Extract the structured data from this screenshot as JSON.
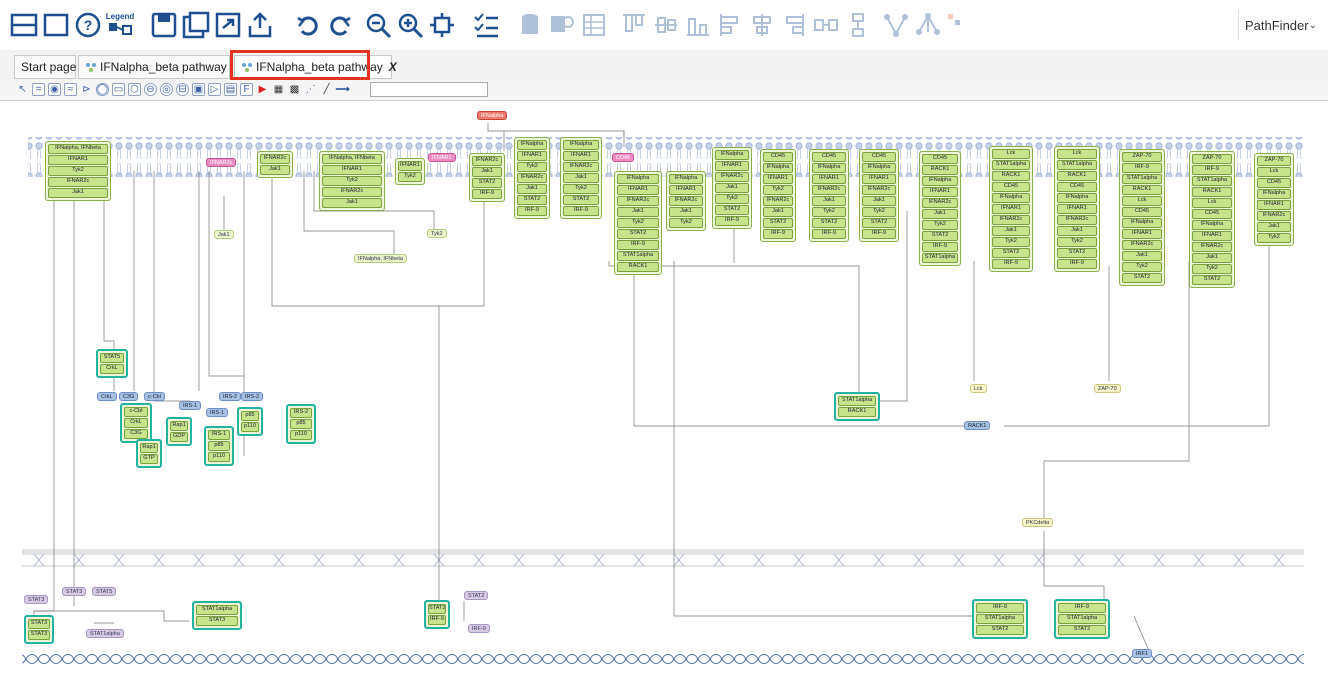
{
  "window": {
    "title": "IFNalpha_beta pathway"
  },
  "toolbar": {
    "legend_label": "Legend",
    "buttons": [
      "layout-panel",
      "single-panel",
      "help",
      "legend",
      "save",
      "save-as",
      "export",
      "upload",
      "undo",
      "redo",
      "zoom-out",
      "zoom-in",
      "fit",
      "checklist",
      "database",
      "search-db",
      "grid",
      "align-top",
      "align-middle",
      "align-bottom",
      "align-left",
      "align-center",
      "align-right",
      "distribute-h",
      "distribute-v",
      "network",
      "tree",
      "small-icon"
    ],
    "pathfinder_label": "PathFinder"
  },
  "tabs": [
    {
      "label": "Start page",
      "active": false
    },
    {
      "label": "IFNalpha_beta pathway ...",
      "active": false
    },
    {
      "label": "IFNalpha_beta pathway",
      "active": true
    }
  ],
  "tab_close_symbol": "X",
  "canvas": {
    "complexes": [
      {
        "id": "c1",
        "items": [
          "IFNalpha, IFNbeta",
          "IFNAR1",
          "Tyk2",
          "IFNAR2c",
          "Jak1"
        ]
      },
      {
        "id": "c2",
        "items": [
          "IFNAR2c",
          "Jak1"
        ]
      },
      {
        "id": "c3",
        "items": [
          "IFNalpha, IFNbeta",
          "IFNAR1",
          "Tyk2",
          "IFNAR2c",
          "Jak1"
        ]
      },
      {
        "id": "c4",
        "items": [
          "IFNAR1",
          "Tyk2"
        ]
      },
      {
        "id": "c5",
        "items": [
          "IFNAR2c",
          "Jak1",
          "STAT2",
          "IRF-9"
        ]
      },
      {
        "id": "c6",
        "items": [
          "IFNalpha",
          "IFNAR1",
          "Tyk2",
          "IFNAR2c",
          "Jak1",
          "STAT2",
          "IRF-9"
        ]
      },
      {
        "id": "c7",
        "items": [
          "IFNalpha",
          "IFNAR1",
          "IFNAR2c",
          "Jak1",
          "Tyk2",
          "STAT2",
          "IRF-9"
        ]
      },
      {
        "id": "c8",
        "items": [
          "IFNalpha",
          "IFNAR1",
          "IFNAR2c",
          "Jak1",
          "Tyk2",
          "STAT2",
          "IRF-9",
          "STAT1alpha",
          "RACK1"
        ]
      },
      {
        "id": "c9",
        "items": [
          "IFNalpha",
          "IFNAR1",
          "IFNAR2c",
          "Jak1",
          "Tyk2"
        ]
      },
      {
        "id": "c10",
        "items": [
          "IFNalpha",
          "IFNAR1",
          "IFNAR2c",
          "Jak1",
          "Tyk2",
          "STAT2",
          "IRF-9"
        ]
      },
      {
        "id": "c11",
        "items": [
          "CD45",
          "IFNalpha",
          "IFNAR1",
          "Tyk2",
          "IFNAR2c",
          "Jak1",
          "STAT2",
          "IRF-9"
        ]
      },
      {
        "id": "c12",
        "items": [
          "CD45",
          "IFNalpha",
          "IFNAR1",
          "IFNAR2c",
          "Jak1",
          "Tyk2",
          "STAT2",
          "IRF-9"
        ]
      },
      {
        "id": "c13",
        "items": [
          "CD45",
          "IFNalpha",
          "IFNAR1",
          "IFNAR2c",
          "Jak1",
          "Tyk2",
          "STAT2",
          "IRF-9"
        ]
      },
      {
        "id": "c14",
        "items": [
          "CD45",
          "RACK1",
          "IFNalpha",
          "IFNAR1",
          "IFNAR2c",
          "Jak1",
          "Tyk2",
          "STAT2",
          "IRF-9",
          "STAT1alpha"
        ]
      },
      {
        "id": "c15",
        "items": [
          "Lck",
          "STAT1alpha",
          "RACK1",
          "CD45",
          "IFNalpha",
          "IFNAR1",
          "IFNAR2c",
          "Jak1",
          "Tyk2",
          "STAT2",
          "IRF-9"
        ]
      },
      {
        "id": "c16",
        "items": [
          "Lck",
          "STAT1alpha",
          "RACK1",
          "CD45",
          "IFNalpha",
          "IFNAR1",
          "IFNAR2c",
          "Jak1",
          "Tyk2",
          "STAT2",
          "IRF-9"
        ]
      },
      {
        "id": "c17",
        "items": [
          "ZAP-70",
          "IRF-9",
          "STAT1alpha",
          "RACK1",
          "Lck",
          "CD45",
          "IFNalpha",
          "IFNAR1",
          "IFNAR2c",
          "Jak1",
          "Tyk2",
          "STAT2"
        ]
      },
      {
        "id": "c18",
        "items": [
          "ZAP-70",
          "IRF-9",
          "STAT1alpha",
          "RACK1",
          "Lck",
          "CD45",
          "IFNalpha",
          "IFNAR1",
          "IFNAR2c",
          "Jak1",
          "Tyk2",
          "STAT2"
        ]
      },
      {
        "id": "c19",
        "items": [
          "ZAP-70",
          "Lck",
          "CD45",
          "IFNalpha",
          "IFNAR1",
          "IFNAR2c",
          "Jak1",
          "Tyk2"
        ]
      },
      {
        "id": "c20",
        "items": [
          "STAT5",
          "CrkL"
        ]
      },
      {
        "id": "c21",
        "items": [
          "c-Cbl",
          "CrkL",
          "C3G"
        ]
      },
      {
        "id": "c22",
        "items": [
          "Rap1",
          "GDP"
        ]
      },
      {
        "id": "c23",
        "items": [
          "Rap1",
          "GTP"
        ]
      },
      {
        "id": "c24",
        "items": [
          "p85",
          "p110"
        ]
      },
      {
        "id": "c25",
        "items": [
          "IRS-1",
          "p85",
          "p110"
        ]
      },
      {
        "id": "c26",
        "items": [
          "IRS-2",
          "p85",
          "p110"
        ]
      },
      {
        "id": "c27",
        "items": [
          "STAT1alpha",
          "RACK1"
        ]
      },
      {
        "id": "c28",
        "items": [
          "STAT3",
          "STAT3"
        ]
      },
      {
        "id": "c29",
        "items": [
          "STAT1alpha",
          "STAT3"
        ]
      },
      {
        "id": "c30",
        "items": [
          "STAT2",
          "IRF-9"
        ]
      },
      {
        "id": "c31",
        "items": [
          "IRF-9",
          "STAT1alpha",
          "STAT2"
        ]
      },
      {
        "id": "c32",
        "items": [
          "IRF-9",
          "STAT1alpha",
          "STAT2"
        ]
      }
    ],
    "labels": {
      "ifnalpha_top": "IFNalpha",
      "ifnar2c_pink": "IFNAR2c",
      "ifnar1_pink": "IFNAR1",
      "cd45_pink": "CD45",
      "jak1": "Jak1",
      "tyk2": "Tyk2",
      "ifn_ab": "IFNalpha, IFNbeta",
      "lck": "Lck",
      "zap70": "ZAP-70",
      "rack1": "RACK1",
      "crkl": "CrkL",
      "c3g": "C3G",
      "ccbl": "c-Cbl",
      "irs1a": "IRS-1",
      "irs1b": "IRS-1",
      "irs2a": "IRS-2",
      "irs2b": "IRS-2",
      "stat3a": "STAT3",
      "stat5": "STAT5",
      "stat3b": "STAT3",
      "stat1alpha": "STAT1alpha",
      "stat2": "STAT2",
      "irf9": "IRF-9",
      "pkcdelta": "PKCdelta",
      "irf1": "IRF1"
    }
  },
  "colors": {
    "highlight": "#e53322",
    "complex_border": "#8bb14a",
    "cell_fill": "#c7e48d",
    "membrane": "#a9bcd9"
  }
}
